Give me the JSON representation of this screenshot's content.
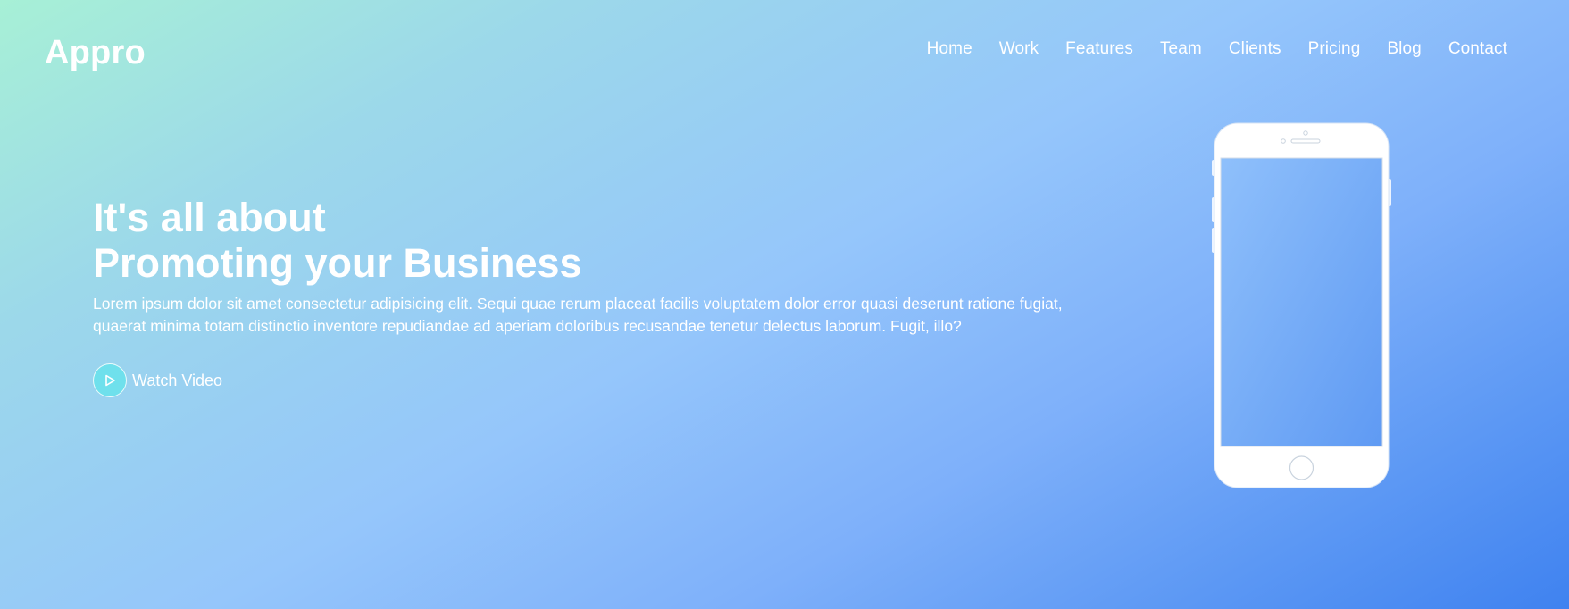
{
  "brand": {
    "name": "Appro"
  },
  "nav": {
    "items": [
      "Home",
      "Work",
      "Features",
      "Team",
      "Clients",
      "Pricing",
      "Blog",
      "Contact"
    ]
  },
  "hero": {
    "headline_line1": "It's all about",
    "headline_line2": "Promoting your Business",
    "description": "Lorem ipsum dolor sit amet consectetur adipisicing elit. Sequi quae rerum placeat facilis voluptatem dolor error quasi deserunt ratione fugiat, quaerat minima totam distinctio inventore repudiandae ad aperiam doloribus recusandae tenetur delectus laborum. Fugit, illo?",
    "watch_video_label": "Watch Video"
  },
  "icons": {
    "play": "play-icon",
    "phone": "phone-mockup"
  },
  "colors": {
    "gradient_start": "#a7f0d6",
    "gradient_mid": "#95c6fb",
    "gradient_end": "#3f82f0",
    "play_button": "#6fe0ec",
    "text": "#ffffff"
  }
}
